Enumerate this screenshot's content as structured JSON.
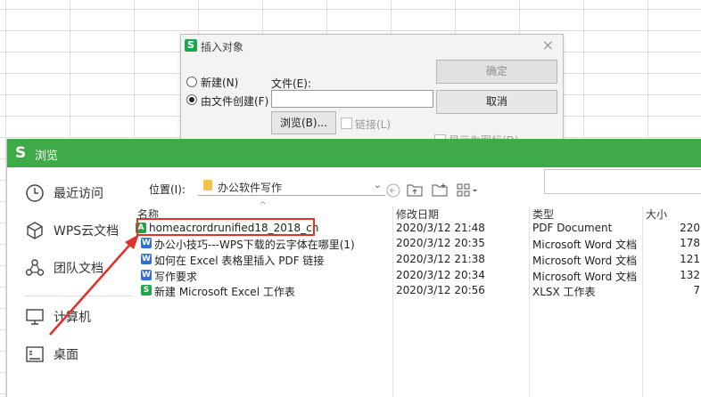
{
  "dialog": {
    "title": "插入对象",
    "radio_new": "新建(N)",
    "radio_from_file": "由文件创建(F)",
    "file_label": "文件(E):",
    "file_value": "",
    "ok": "确定",
    "cancel": "取消",
    "browse": "浏览(B)...",
    "link": "链接(L)",
    "display_as_icon": "显示为图标(D)"
  },
  "browse": {
    "title": "浏览",
    "sidebar": [
      {
        "label": "最近访问",
        "icon": "clock-icon"
      },
      {
        "label": "WPS云文档",
        "icon": "cloud-cube-icon"
      },
      {
        "label": "团队文档",
        "icon": "team-icon"
      },
      {
        "label": "计算机",
        "icon": "computer-icon"
      },
      {
        "label": "桌面",
        "icon": "desktop-icon"
      }
    ],
    "location_label": "位置(I):",
    "location_value": "办公软件写作",
    "columns": {
      "name": "名称",
      "date": "修改日期",
      "type": "类型",
      "size": "大小"
    },
    "files": [
      {
        "name": "homeacrordrunified18_2018_cn",
        "date": "2020/3/12 21:48",
        "type": "PDF Document",
        "size": "220",
        "icon": "pdf-icon",
        "color": "#20a04a"
      },
      {
        "name": "办公小技巧---WPS下载的云字体在哪里(1)",
        "date": "2020/3/12 20:35",
        "type": "Microsoft Word 文档",
        "size": "178",
        "icon": "word-icon",
        "color": "#2f6fd6"
      },
      {
        "name": "如何在 Excel 表格里插入 PDF 链接",
        "date": "2020/3/12 21:38",
        "type": "Microsoft Word 文档",
        "size": "121",
        "icon": "word-icon",
        "color": "#2f6fd6"
      },
      {
        "name": "写作要求",
        "date": "2020/3/12 20:34",
        "type": "Microsoft Word 文档",
        "size": "132",
        "icon": "word-icon",
        "color": "#2f6fd6"
      },
      {
        "name": "新建 Microsoft Excel 工作表",
        "date": "2020/3/12 20:56",
        "type": "XLSX 工作表",
        "size": "7",
        "icon": "excel-icon",
        "color": "#1aa84d"
      }
    ]
  },
  "colors": {
    "accent": "#3eaa48",
    "highlight": "#e0312b"
  }
}
